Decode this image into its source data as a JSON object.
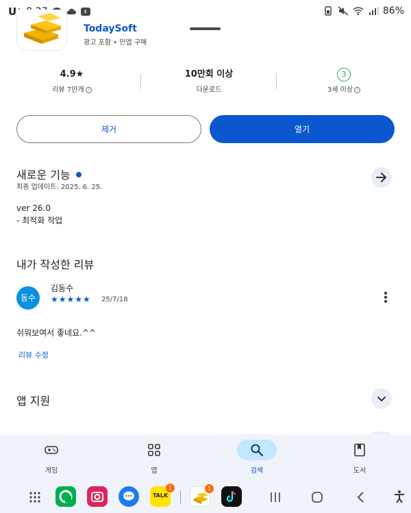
{
  "status_bar": {
    "carrier": "U⁺",
    "time": "8:27",
    "battery": "86%"
  },
  "app": {
    "developer": "TodaySoft",
    "meta": "광고 포함 • 인앱 구매"
  },
  "stats": [
    {
      "value": "4.9★",
      "label": "리뷰 7만개"
    },
    {
      "value": "10만회 이상",
      "label": "다운로드"
    },
    {
      "value": "3",
      "label": "3세 이상"
    }
  ],
  "actions": {
    "remove": "제거",
    "open": "열기"
  },
  "whats_new": {
    "title": "새로운 기능",
    "updated": "최종 업데이트: 2025. 6. 25.",
    "version": "ver 26.0",
    "note": "- 최적화 작업"
  },
  "my_review": {
    "title": "내가 작성한 리뷰",
    "avatar_text": "동수",
    "reviewer": "김동수",
    "stars": "★★★★★",
    "rating": 5,
    "date": "25/7/18",
    "text": "쉬워보여서 좋네요.^^",
    "edit_label": "리뷰 수정"
  },
  "app_support": {
    "title": "앱 지원"
  },
  "bottom_nav": {
    "items": [
      {
        "label": "게임",
        "icon": "gamepad-icon"
      },
      {
        "label": "앱",
        "icon": "apps-grid-icon"
      },
      {
        "label": "검색",
        "icon": "search-icon",
        "active": true
      },
      {
        "label": "도서",
        "icon": "book-icon"
      }
    ]
  },
  "taskbar": {
    "kakaotalk_label": "TALK",
    "kakaotalk_badge": "1",
    "gold_badge": "1"
  },
  "colors": {
    "accent": "#0b57d0",
    "nav_active": "#c2e7ff",
    "age_rating": "#34a853",
    "avatar": "#0d8fe0"
  }
}
